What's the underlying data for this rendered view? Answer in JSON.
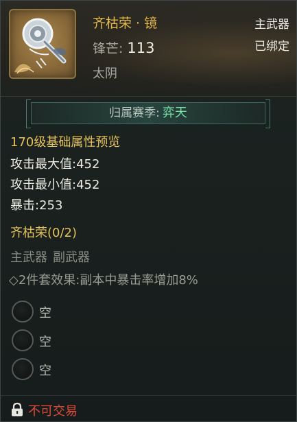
{
  "item": {
    "icon": "mirror-weapon-icon",
    "name": "齐枯荣 · 镜",
    "power_label": "锋芒:",
    "power_value": "113",
    "attribute": "太阴",
    "slot_type": "主武器",
    "bind_state": "已绑定"
  },
  "season": {
    "label": "归属赛季:",
    "value": "弈天"
  },
  "base_stats": {
    "title": "170级基础属性预览",
    "lines": [
      "攻击最大值:452",
      "攻击最小值:452",
      "暴击:253"
    ]
  },
  "set": {
    "title": "齐枯荣(0/2)",
    "members": [
      "主武器",
      "副武器"
    ],
    "effect": "◇2件套效果:副本中暴击率增加8%"
  },
  "gem_slots": [
    {
      "label": "空"
    },
    {
      "label": "空"
    },
    {
      "label": "空"
    }
  ],
  "footer": {
    "icon": "lock-icon",
    "trade_status": "不可交易"
  },
  "colors": {
    "item_name": "#e5b84a",
    "season_value": "#77e0a6",
    "section_title": "#e5c25a",
    "trade_status": "#e04a3a"
  }
}
